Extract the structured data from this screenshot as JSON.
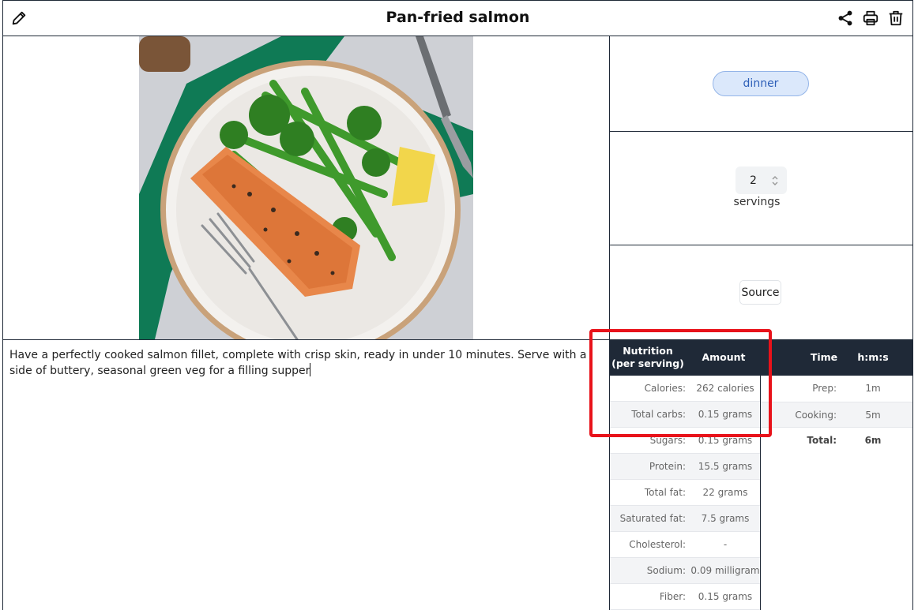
{
  "header": {
    "title": "Pan-fried salmon",
    "icons": {
      "edit": "pencil-icon",
      "share": "share-icon",
      "print": "printer-icon",
      "delete": "trash-icon"
    }
  },
  "recipe": {
    "description": "Have a perfectly cooked salmon fillet, complete with crisp skin, ready in under 10 minutes. Serve with a side of buttery, seasonal green veg for a filling supper",
    "tag": "dinner",
    "servings_value": "2",
    "servings_label": "servings",
    "source_label": "Source"
  },
  "nutrition": {
    "header_col1": "Nutrition (per serving)",
    "header_col1_line1": "Nutrition",
    "header_col1_line2": "(per serving)",
    "header_col2": "Amount",
    "rows": [
      {
        "label": "Calories:",
        "value": "262 calories"
      },
      {
        "label": "Total carbs:",
        "value": "0.15 grams"
      },
      {
        "label": "Sugars:",
        "value": "0.15 grams"
      },
      {
        "label": "Protein:",
        "value": "15.5 grams"
      },
      {
        "label": "Total fat:",
        "value": "22 grams"
      },
      {
        "label": "Saturated fat:",
        "value": "7.5 grams"
      },
      {
        "label": "Cholesterol:",
        "value": "-"
      },
      {
        "label": "Sodium:",
        "value": "0.09 milligram"
      },
      {
        "label": "Fiber:",
        "value": "0.15 grams"
      }
    ]
  },
  "timing": {
    "header_col1": "Time",
    "header_col2": "h:m:s",
    "rows": [
      {
        "label": "Prep:",
        "value": "1m"
      },
      {
        "label": "Cooking:",
        "value": "5m"
      },
      {
        "label": "Total:",
        "value": "6m"
      }
    ]
  },
  "colors": {
    "header_dark": "#1f2937",
    "tag_bg": "#dbe8fb",
    "tag_text": "#2d5fb8",
    "highlight": "#e8121a"
  }
}
